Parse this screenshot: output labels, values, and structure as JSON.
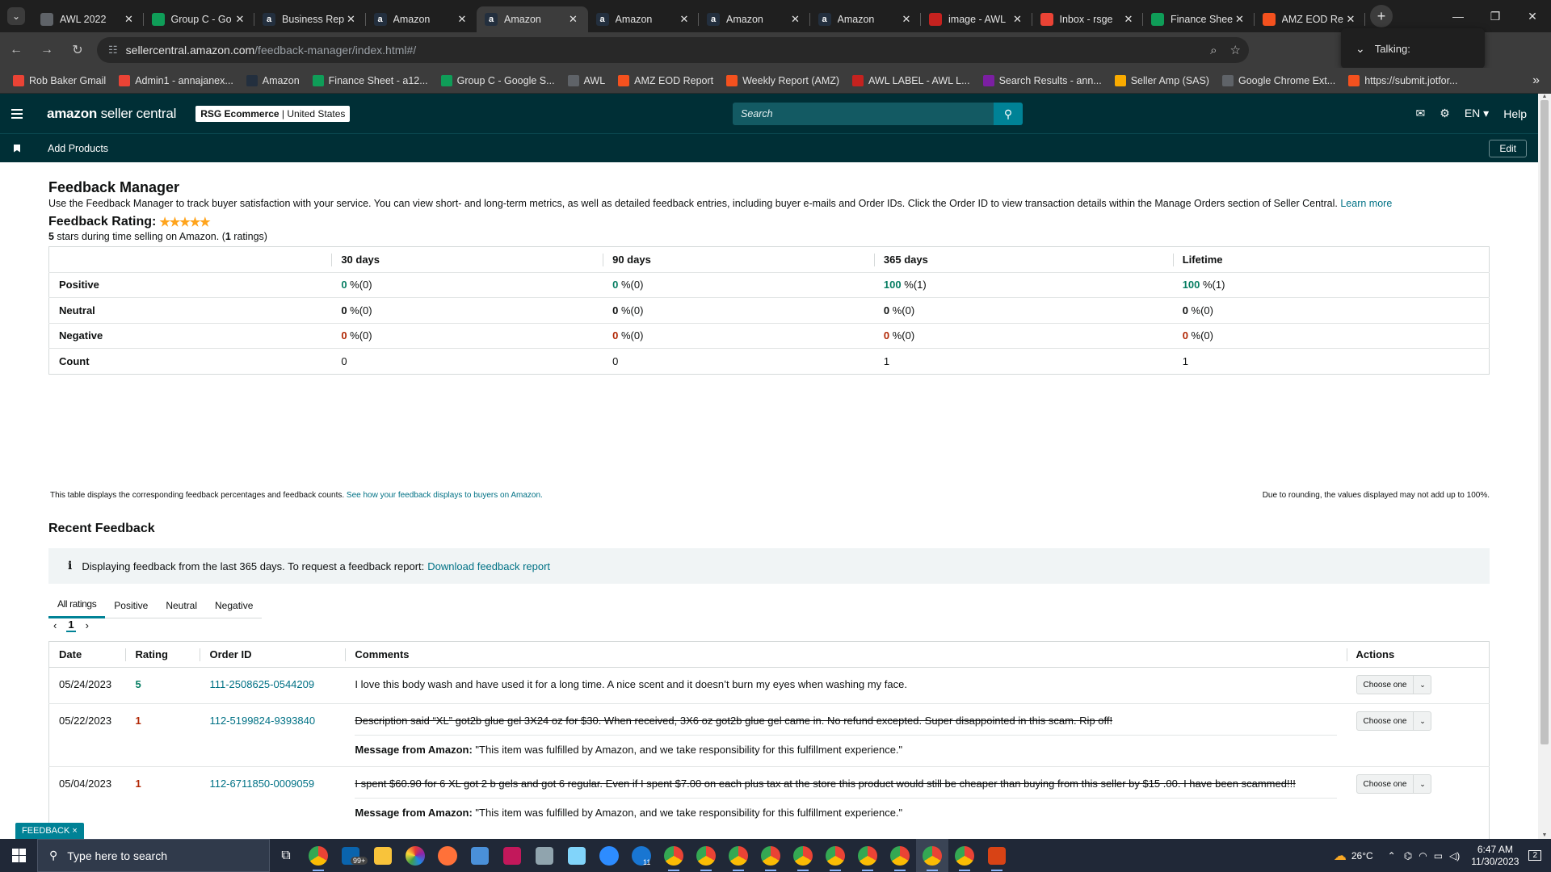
{
  "browser": {
    "tabs": [
      {
        "title": "AWL 2022",
        "icon": "globe-icon",
        "color": "#5f6368"
      },
      {
        "title": "Group C - Go",
        "icon": "sheets-icon",
        "color": "#0f9d58"
      },
      {
        "title": "Business Rep",
        "icon": "amazon-icon",
        "color": "#232f3e"
      },
      {
        "title": "Amazon",
        "icon": "amazon-icon",
        "color": "#232f3e"
      },
      {
        "title": "Amazon",
        "icon": "amazon-icon",
        "color": "#232f3e"
      },
      {
        "title": "Amazon",
        "icon": "amazon-icon",
        "color": "#232f3e"
      },
      {
        "title": "Amazon",
        "icon": "amazon-icon",
        "color": "#232f3e"
      },
      {
        "title": "Amazon",
        "icon": "amazon-icon",
        "color": "#232f3e"
      },
      {
        "title": "image - AWL",
        "icon": "awl-icon",
        "color": "#c5221f"
      },
      {
        "title": "Inbox - rsge",
        "icon": "gmail-icon",
        "color": "#ea4335"
      },
      {
        "title": "Finance Shee",
        "icon": "sheets-icon",
        "color": "#0f9d58"
      },
      {
        "title": "AMZ EOD Re",
        "icon": "forms-icon",
        "color": "#f4511e"
      }
    ],
    "url_host": "sellercentral.amazon.com",
    "url_path": "/feedback-manager/index.html#/",
    "talking_label": "Talking:",
    "bookmarks": [
      {
        "label": "Rob Baker Gmail",
        "color": "#ea4335"
      },
      {
        "label": "Admin1 - annajanex...",
        "color": "#ea4335"
      },
      {
        "label": "Amazon",
        "color": "#232f3e"
      },
      {
        "label": "Finance Sheet - a12...",
        "color": "#0f9d58"
      },
      {
        "label": "Group C - Google S...",
        "color": "#0f9d58"
      },
      {
        "label": "AWL",
        "color": "#5f6368"
      },
      {
        "label": "AMZ EOD Report",
        "color": "#f4511e"
      },
      {
        "label": "Weekly Report (AMZ)",
        "color": "#f4511e"
      },
      {
        "label": "AWL LABEL - AWL L...",
        "color": "#c5221f"
      },
      {
        "label": "Search Results - ann...",
        "color": "#7b1fa2"
      },
      {
        "label": "Seller Amp (SAS)",
        "color": "#f9ab00"
      },
      {
        "label": "Google Chrome Ext...",
        "color": "#5f6368"
      },
      {
        "label": "https://submit.jotfor...",
        "color": "#f4511e"
      }
    ]
  },
  "header": {
    "logo_bold": "amazon",
    "logo_rest": " seller central",
    "account_name": "RSG Ecommerce",
    "account_region": " | United States",
    "search_placeholder": "Search",
    "lang": "EN",
    "help": "Help",
    "subnav_link": "Add Products",
    "edit": "Edit"
  },
  "page": {
    "title": "Feedback Manager",
    "description": "Use the Feedback Manager to track buyer satisfaction with your service. You can view short- and long-term metrics, as well as detailed feedback entries, including buyer e-mails and Order IDs. Click the Order ID to view transaction details within the Manage Orders section of Seller Central.",
    "learn_more": "Learn more",
    "rating_label": "Feedback Rating:",
    "stars": "★★★★★",
    "rating_stars_value": "5",
    "rating_sub_mid": " stars during time selling on Amazon. (",
    "rating_count": "1",
    "rating_sub_end": " ratings)",
    "metrics": {
      "columns": [
        "30 days",
        "90 days",
        "365 days",
        "Lifetime"
      ],
      "rows": [
        {
          "label": "Positive",
          "cells": [
            [
              "0",
              " %(0)"
            ],
            [
              "0",
              " %(0)"
            ],
            [
              "100",
              " %(1)"
            ],
            [
              "100",
              " %(1)"
            ]
          ]
        },
        {
          "label": "Neutral",
          "cells": [
            [
              "0",
              " %(0)"
            ],
            [
              "0",
              " %(0)"
            ],
            [
              "0",
              " %(0)"
            ],
            [
              "0",
              " %(0)"
            ]
          ]
        },
        {
          "label": "Negative",
          "cells": [
            [
              "0",
              " %(0)"
            ],
            [
              "0",
              " %(0)"
            ],
            [
              "0",
              " %(0)"
            ],
            [
              "0",
              " %(0)"
            ]
          ]
        },
        {
          "label": "Count",
          "cells": [
            [
              "",
              "0"
            ],
            [
              "",
              "0"
            ],
            [
              "",
              "1"
            ],
            [
              "",
              "1"
            ]
          ]
        }
      ]
    },
    "table_note": "This table displays the corresponding feedback percentages and feedback counts.",
    "table_note_link": "See how your feedback displays to buyers on Amazon.",
    "rounding_note": "Due to rounding, the values displayed may not add up to 100%.",
    "recent_title": "Recent Feedback",
    "info_icon": "i",
    "info_text": "Displaying feedback from the last 365 days. To request a feedback report:",
    "info_link": "Download feedback report",
    "rating_tabs": [
      "All ratings",
      "Positive",
      "Neutral",
      "Negative"
    ],
    "page_current": "1",
    "feedback_columns": [
      "Date",
      "Rating",
      "Order ID",
      "Comments",
      "Actions"
    ],
    "feedback": [
      {
        "date": "05/24/2023",
        "rating": "5",
        "order_id": "111-2508625-0544209",
        "comment": "I love this body wash and have used it for a long time. A nice scent and it doesn’t burn my eyes when washing my face.",
        "struck": false,
        "message_label": "",
        "message": "",
        "action": "Choose one"
      },
      {
        "date": "05/22/2023",
        "rating": "1",
        "order_id": "112-5199824-9393840",
        "comment": "Description said “XL” got2b glue gel 3X24 oz for $30. When received, 3X6 oz got2b glue gel came in. No refund excepted. Super disappointed in this scam. Rip off!",
        "struck": true,
        "message_label": "Message from Amazon:",
        "message": " \"This item was fulfilled by Amazon, and we take responsibility for this fulfillment experience.\"",
        "action": "Choose one"
      },
      {
        "date": "05/04/2023",
        "rating": "1",
        "order_id": "112-6711850-0009059",
        "comment": "I spent $60.90 for 6 XL got 2 b gels and got 6 regular. Even if I spent $7.00 on each plus tax at the store this product would still be cheaper than buying from this seller by $15 .00. I have been scammed!!!",
        "struck": true,
        "message_label": "Message from Amazon:",
        "message": " \"This item was fulfilled by Amazon, and we take responsibility for this fulfillment experience.\"",
        "action": "Choose one"
      }
    ],
    "feedback_tab": "FEEDBACK ×"
  },
  "taskbar": {
    "search_placeholder": "Type here to search",
    "badge_mail": "99+",
    "badge_phone": "11",
    "temp": "26°C",
    "time": "6:47 AM",
    "date": "11/30/2023",
    "notif": "2"
  },
  "colors": {
    "brand_dark": "#002f36",
    "link": "#007185",
    "positive": "#067d62",
    "negative": "#b12704",
    "star": "#ffa41c"
  }
}
